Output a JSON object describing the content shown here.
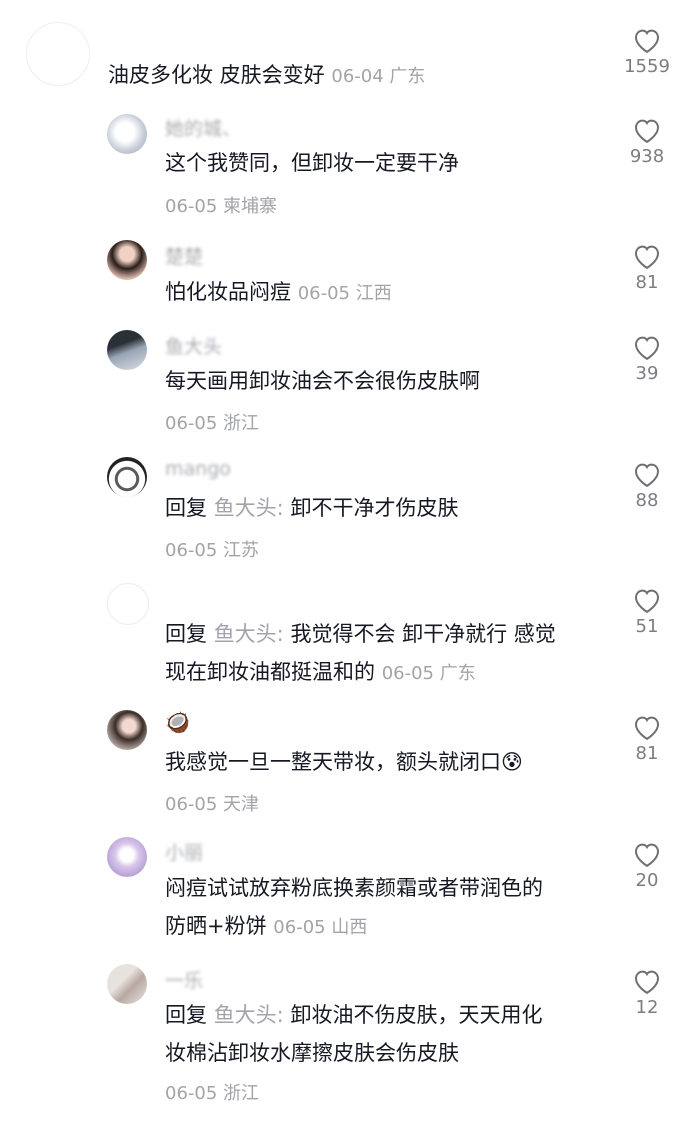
{
  "comments": [
    {
      "username": "",
      "text": "油皮多化妆 皮肤会变好",
      "date": "06-04",
      "location": "广东",
      "likes": "1559"
    },
    {
      "username": "她的城、",
      "text": "这个我赞同，但卸妆一定要干净",
      "date": "06-05",
      "location": "柬埔寨",
      "likes": "938"
    },
    {
      "username": "楚楚",
      "text": "怕化妆品闷痘",
      "date": "06-05",
      "location": "江西",
      "likes": "81"
    },
    {
      "username": "鱼大头",
      "text": "每天画用卸妆油会不会很伤皮肤啊",
      "date": "06-05",
      "location": "浙江",
      "likes": "39"
    },
    {
      "username": "mango",
      "reply_label": "回复",
      "reply_to": "鱼大头:",
      "text": "卸不干净才伤皮肤",
      "date": "06-05",
      "location": "江苏",
      "likes": "88"
    },
    {
      "username": "",
      "reply_label": "回复",
      "reply_to": "鱼大头:",
      "text_line1": "我觉得不会 卸干净就行 感觉",
      "text_line2": "现在卸妆油都挺温和的",
      "date": "06-05",
      "location": "广东",
      "likes": "51"
    },
    {
      "username": "🥥",
      "text": "我感觉一旦一整天带妆，额头就闭口",
      "emoji": "😰",
      "date": "06-05",
      "location": "天津",
      "likes": "81"
    },
    {
      "username": "小丽",
      "text_line1": "闷痘试试放弃粉底换素颜霜或者带润色的",
      "text_line2": "防晒+粉饼",
      "date": "06-05",
      "location": "山西",
      "likes": "20"
    },
    {
      "username": "一乐",
      "reply_label": "回复",
      "reply_to": "鱼大头:",
      "text_line1": "卸妆油不伤皮肤，天天用化",
      "text_line2": "妆棉沾卸妆水摩擦皮肤会伤皮肤",
      "date": "06-05",
      "location": "浙江",
      "likes": "12"
    }
  ],
  "colors": {
    "text": "#161823",
    "muted": "#a2a4a9",
    "heart_stroke": "#6d6f75"
  },
  "icons": {
    "like": "heart-outline-icon"
  }
}
